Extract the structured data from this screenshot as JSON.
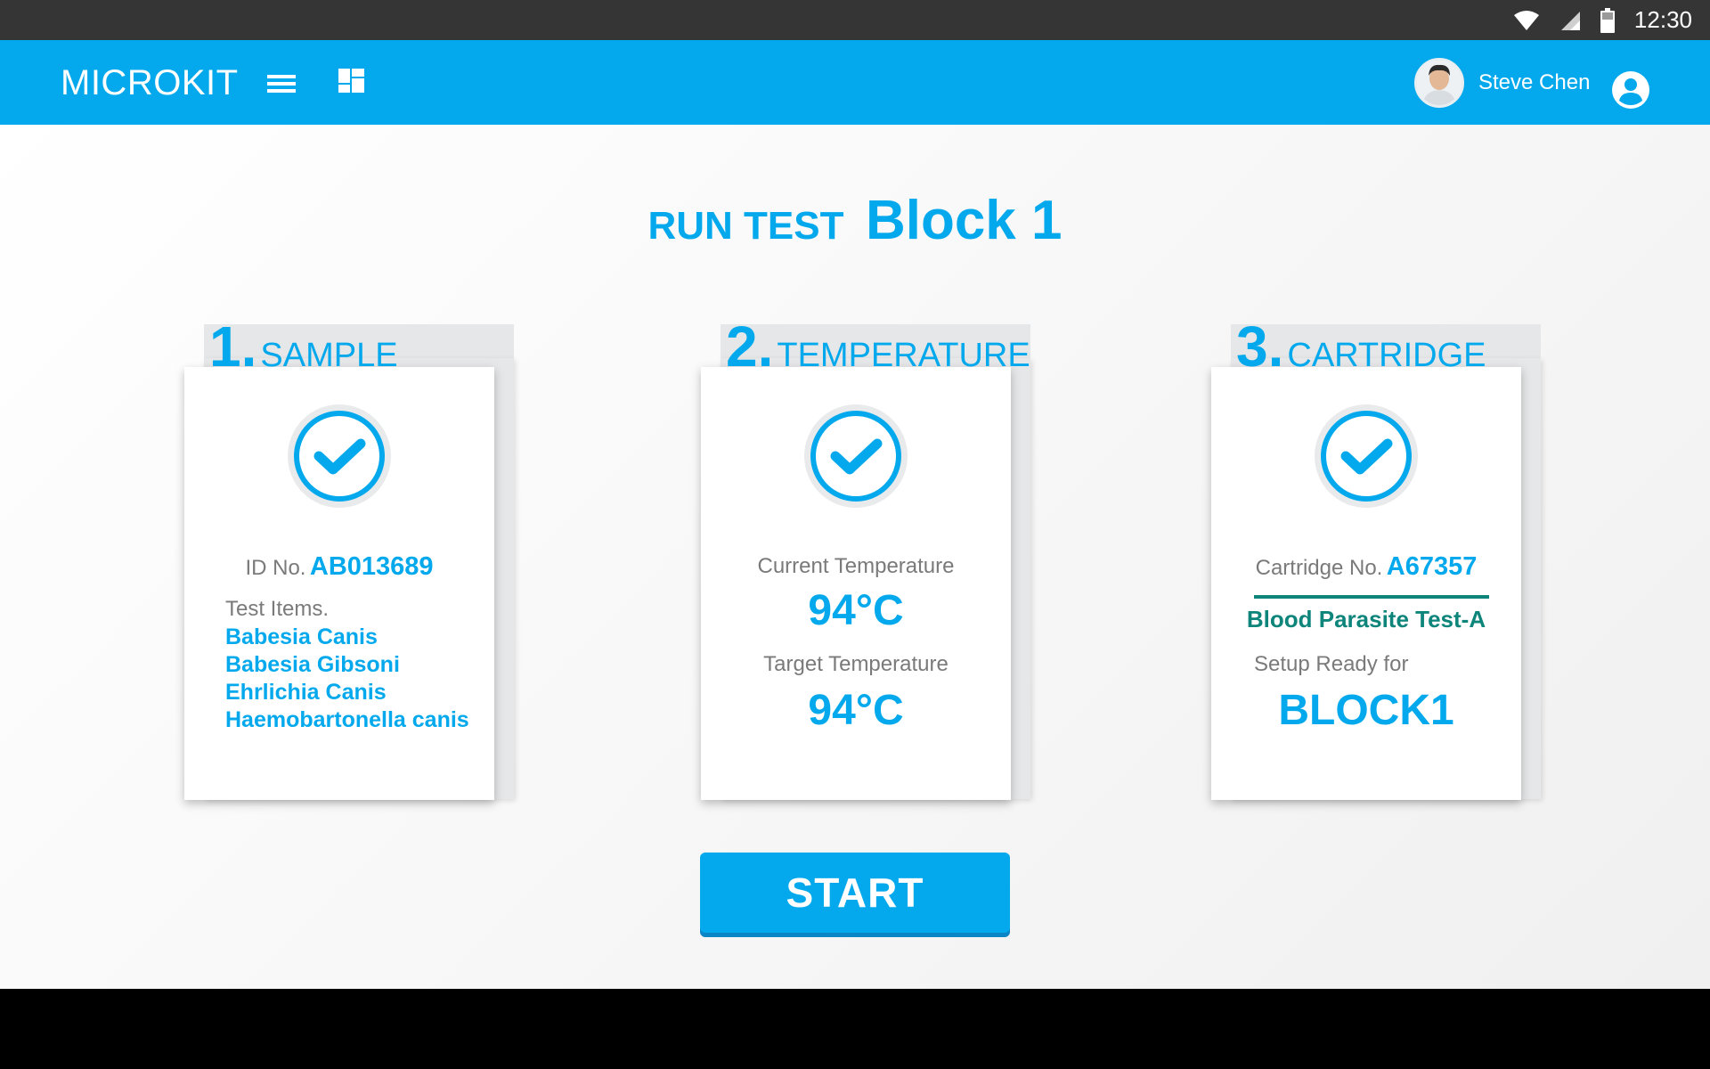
{
  "status_bar": {
    "time": "12:30"
  },
  "app_bar": {
    "title": "MICROKIT",
    "user_name": "Steve Chen"
  },
  "page": {
    "run_label": "RUN TEST",
    "block_label": "Block 1"
  },
  "steps": [
    {
      "number": "1.",
      "title": "SAMPLE",
      "id_label": "ID No.",
      "id_value": "AB013689",
      "test_items_label": "Test Items.",
      "test_items": [
        "Babesia Canis",
        "Babesia Gibsoni",
        "Ehrlichia Canis",
        "Haemobartonella canis"
      ]
    },
    {
      "number": "2.",
      "title": "TEMPERATURE",
      "current_label": "Current Temperature",
      "current_value": "94°C",
      "target_label": "Target Temperature",
      "target_value": "94°C"
    },
    {
      "number": "3.",
      "title": "CARTRIDGE",
      "cartridge_label": "Cartridge No.",
      "cartridge_value": "A67357",
      "test_name": "Blood Parasite Test-A",
      "setup_label": "Setup Ready for",
      "setup_value": "BLOCK1"
    }
  ],
  "start_button": "START",
  "colors": {
    "accent": "#03a9ec",
    "status_bar": "#353535",
    "teal": "#0e857b"
  },
  "icons": [
    "wifi-icon",
    "cell-signal-icon",
    "battery-icon",
    "menu-icon",
    "dashboard-icon",
    "account-circle-icon",
    "check-icon"
  ]
}
